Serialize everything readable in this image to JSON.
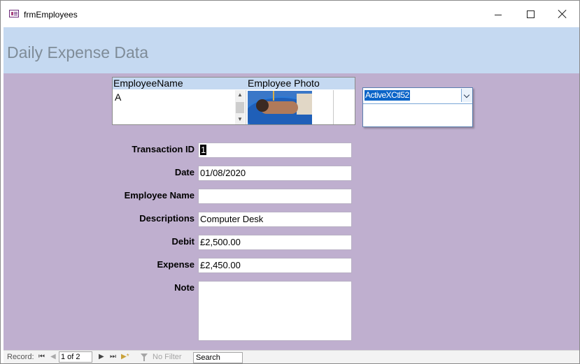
{
  "window": {
    "title": "frmEmployees"
  },
  "header": {
    "title": "Daily Expense Data"
  },
  "subform": {
    "columns": [
      "EmployeeName",
      "Employee Photo"
    ],
    "row": {
      "employee_name": "A"
    }
  },
  "activex": {
    "value": "ActiveXCtl52"
  },
  "fields": {
    "transaction_id": {
      "label": "Transaction ID",
      "value": "1"
    },
    "date": {
      "label": "Date",
      "value": "01/08/2020"
    },
    "employee_name": {
      "label": "Employee Name",
      "value": ""
    },
    "descriptions": {
      "label": "Descriptions",
      "value": "Computer Desk"
    },
    "debit": {
      "label": "Debit",
      "value": "£2,500.00"
    },
    "expense": {
      "label": "Expense",
      "value": "£2,450.00"
    },
    "note": {
      "label": "Note",
      "value": ""
    }
  },
  "statusbar": {
    "record_label": "Record:",
    "record_position": "1 of 2",
    "filter_label": "No Filter",
    "search_placeholder": "Search",
    "nav": {
      "first": "⏮",
      "prev": "◀",
      "next": "▶",
      "last": "⏭",
      "new": "▶*"
    }
  }
}
